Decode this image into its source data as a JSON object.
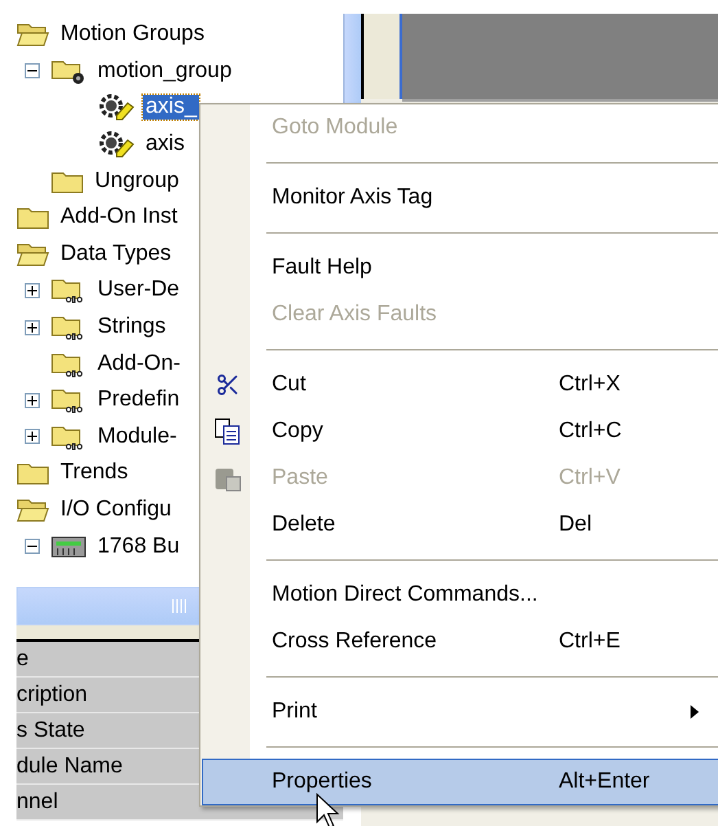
{
  "tree": [
    {
      "label": "Motion Groups",
      "kind": "open-folder",
      "selected": false,
      "children": [
        {
          "label": "motion_group",
          "kind": "group",
          "expanded": true,
          "selected": false,
          "children": [
            {
              "label": "axis_",
              "kind": "axis",
              "selected": true
            },
            {
              "label": "axis",
              "kind": "axis",
              "selected": false
            }
          ]
        },
        {
          "label": "Ungroup",
          "kind": "folder",
          "selected": false
        }
      ]
    },
    {
      "label": "Add-On Inst",
      "kind": "folder",
      "selected": false
    },
    {
      "label": "Data Types",
      "kind": "open-folder",
      "selected": false,
      "children": [
        {
          "label": "User-De",
          "kind": "datatype",
          "expanded": false,
          "selected": false
        },
        {
          "label": "Strings",
          "kind": "datatype",
          "expanded": false,
          "selected": false
        },
        {
          "label": "Add-On-",
          "kind": "datatype",
          "selected": false
        },
        {
          "label": "Predefin",
          "kind": "datatype",
          "expanded": false,
          "selected": false
        },
        {
          "label": "Module-",
          "kind": "datatype",
          "expanded": false,
          "selected": false
        }
      ]
    },
    {
      "label": "Trends",
      "kind": "folder",
      "selected": false
    },
    {
      "label": "I/O Configu",
      "kind": "open-folder",
      "selected": false,
      "children": [
        {
          "label": "1768 Bu",
          "kind": "module",
          "expanded": true,
          "selected": false
        }
      ]
    }
  ],
  "properties": [
    "e",
    "cription",
    "s State",
    "dule Name",
    "nnel"
  ],
  "menu": [
    {
      "kind": "item",
      "label": "Goto Module",
      "disabled": true,
      "selected": false
    },
    {
      "kind": "separator"
    },
    {
      "kind": "item",
      "label": "Monitor Axis Tag",
      "disabled": false,
      "selected": false
    },
    {
      "kind": "separator"
    },
    {
      "kind": "item",
      "label": "Fault Help",
      "disabled": false,
      "selected": false
    },
    {
      "kind": "item",
      "label": "Clear Axis Faults",
      "disabled": true,
      "selected": false
    },
    {
      "kind": "separator"
    },
    {
      "kind": "cut",
      "label": "Cut",
      "shortcut": "Ctrl+X",
      "disabled": false,
      "selected": false
    },
    {
      "kind": "copy",
      "label": "Copy",
      "shortcut": "Ctrl+C",
      "disabled": false,
      "selected": false
    },
    {
      "kind": "paste",
      "label": "Paste",
      "shortcut": "Ctrl+V",
      "disabled": true,
      "selected": false
    },
    {
      "kind": "item",
      "label": "Delete",
      "shortcut": "Del",
      "disabled": false,
      "selected": false
    },
    {
      "kind": "separator"
    },
    {
      "kind": "item",
      "label": "Motion Direct Commands...",
      "disabled": false,
      "selected": false
    },
    {
      "kind": "item",
      "label": "Cross Reference",
      "shortcut": "Ctrl+E",
      "disabled": false,
      "selected": false
    },
    {
      "kind": "separator"
    },
    {
      "kind": "item",
      "label": "Print",
      "submenu": true,
      "disabled": false,
      "selected": false
    },
    {
      "kind": "separator"
    },
    {
      "kind": "item",
      "label": "Properties",
      "shortcut": "Alt+Enter",
      "disabled": false,
      "selected": true
    }
  ]
}
